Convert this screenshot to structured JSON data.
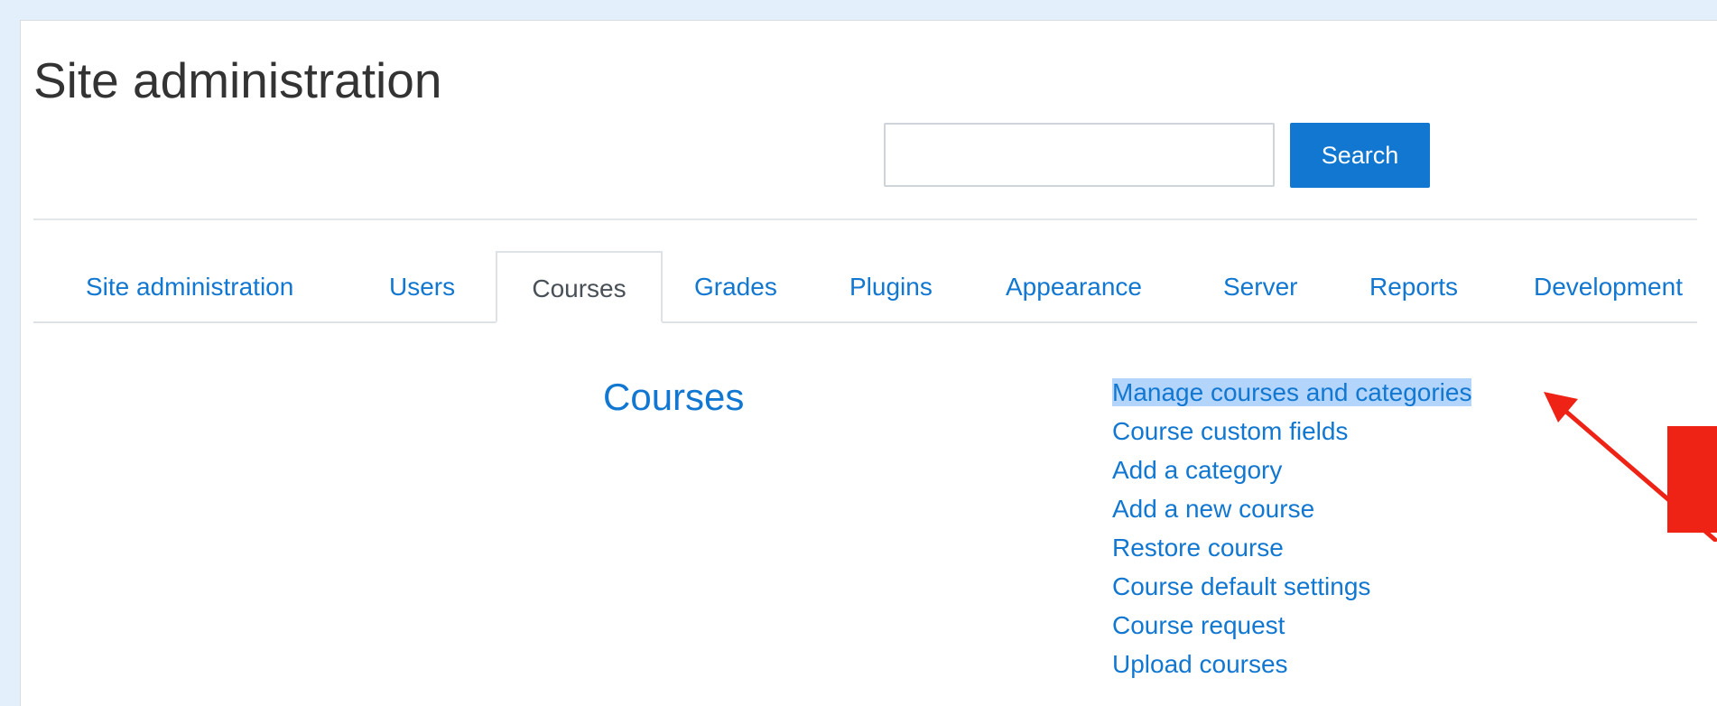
{
  "header": {
    "title": "Site administration"
  },
  "search": {
    "value": "",
    "placeholder": "",
    "button_label": "Search"
  },
  "tabs": [
    {
      "label": "Site administration",
      "active": false
    },
    {
      "label": "Users",
      "active": false
    },
    {
      "label": "Courses",
      "active": true
    },
    {
      "label": "Grades",
      "active": false
    },
    {
      "label": "Plugins",
      "active": false
    },
    {
      "label": "Appearance",
      "active": false
    },
    {
      "label": "Server",
      "active": false
    },
    {
      "label": "Reports",
      "active": false
    },
    {
      "label": "Development",
      "active": false
    }
  ],
  "section": {
    "heading": "Courses",
    "links": [
      {
        "label": "Manage courses and categories",
        "highlighted": true
      },
      {
        "label": "Course custom fields",
        "highlighted": false
      },
      {
        "label": "Add a category",
        "highlighted": false
      },
      {
        "label": "Add a new course",
        "highlighted": false
      },
      {
        "label": "Restore course",
        "highlighted": false
      },
      {
        "label": "Course default settings",
        "highlighted": false
      },
      {
        "label": "Course request",
        "highlighted": false
      },
      {
        "label": "Upload courses",
        "highlighted": false
      }
    ]
  },
  "colors": {
    "link": "#1177d1",
    "primary_button": "#1177d1",
    "selection_highlight": "#b3d5fb",
    "annotation": "#ee2316",
    "page_background": "#e3f0fb"
  }
}
